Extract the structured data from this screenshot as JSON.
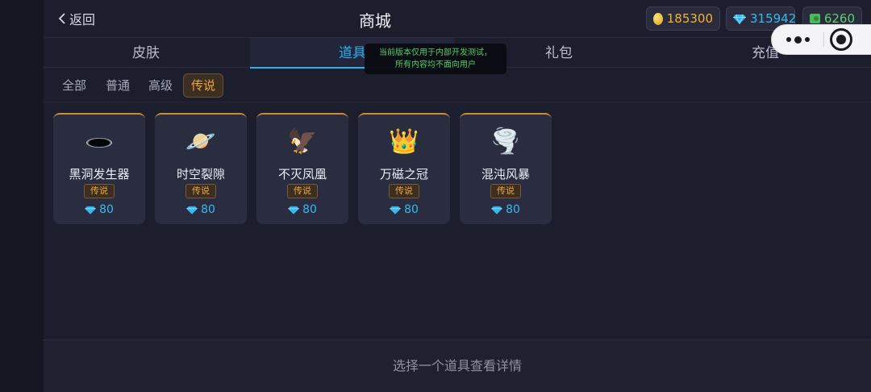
{
  "header": {
    "back_label": "返回",
    "title": "商城",
    "coins": "185300",
    "gems": "315942",
    "cash": "6260"
  },
  "tabs": [
    {
      "label": "皮肤"
    },
    {
      "label": "道具"
    },
    {
      "label": "礼包"
    },
    {
      "label": "充值"
    }
  ],
  "toast": {
    "line1": "当前版本仅用于内部开发测试，",
    "line2": "所有内容均不面向用户"
  },
  "filters": [
    {
      "label": "全部"
    },
    {
      "label": "普通"
    },
    {
      "label": "高级"
    },
    {
      "label": "传说"
    }
  ],
  "items": [
    {
      "name": "黑洞发生器",
      "rarity": "传说",
      "price": "80",
      "icon": "black-hole-icon"
    },
    {
      "name": "时空裂隙",
      "rarity": "传说",
      "price": "80",
      "icon": "planet-icon"
    },
    {
      "name": "不灭凤凰",
      "rarity": "传说",
      "price": "80",
      "icon": "eagle-icon"
    },
    {
      "name": "万磁之冠",
      "rarity": "传说",
      "price": "80",
      "icon": "crown-icon"
    },
    {
      "name": "混沌风暴",
      "rarity": "传说",
      "price": "80",
      "icon": "tornado-icon"
    }
  ],
  "bottom_hint": "选择一个道具查看详情",
  "colors": {
    "accent_blue": "#2bb1ee",
    "legend_orange": "#f0a53a",
    "coin_gold": "#f2b233",
    "gem_blue": "#39b8f0",
    "cash_green": "#5cd06a",
    "toast_text": "#54d66b"
  }
}
